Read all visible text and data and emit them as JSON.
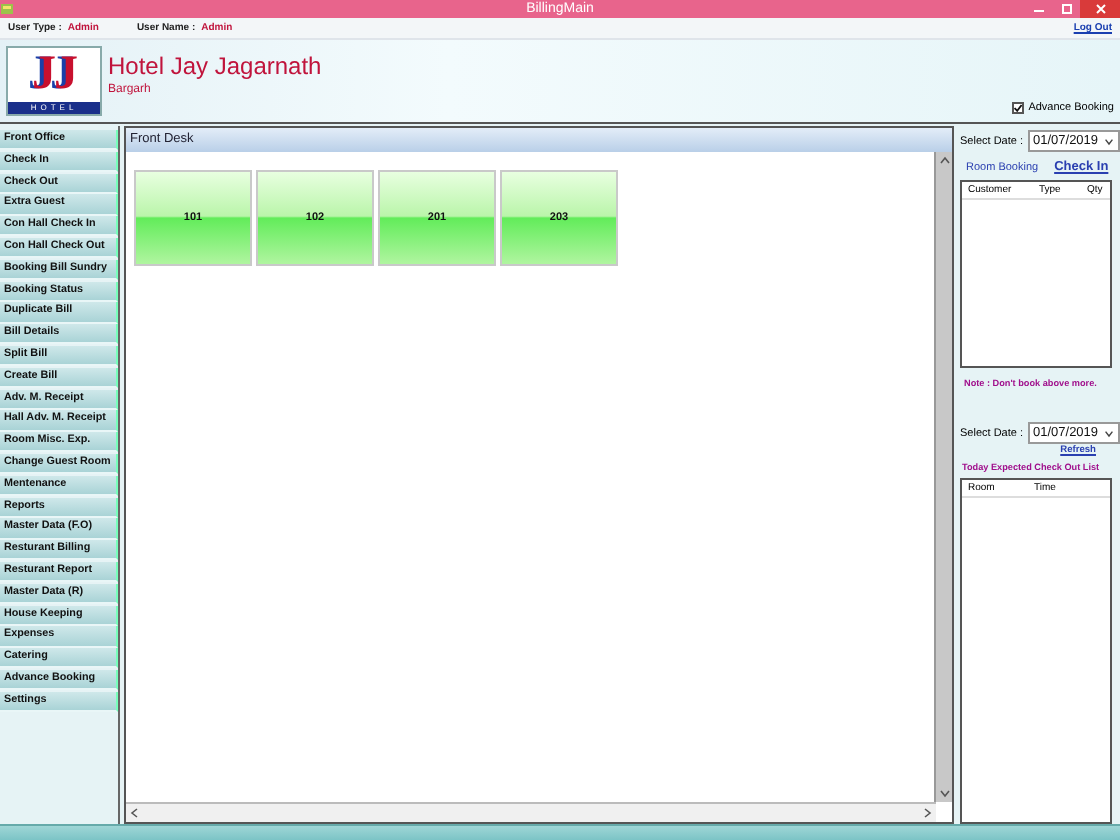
{
  "window": {
    "title": "BillingMain"
  },
  "user_bar": {
    "user_type_label": "User Type :",
    "user_type": "Admin",
    "user_name_label": "User Name :",
    "user_name": "Admin",
    "logout": "Log Out"
  },
  "hotel": {
    "logo_letters": "JJ",
    "logo_caption": "HOTEL",
    "name": "Hotel Jay Jagarnath",
    "location": "Bargarh"
  },
  "advance_booking": {
    "label": "Advance Booking",
    "checked": true
  },
  "menu": [
    "Front Office",
    "Check In",
    "Check Out",
    "Extra Guest",
    "Con Hall Check In",
    "Con Hall Check Out",
    "Booking Bill Sundry",
    "Booking Status",
    "Duplicate Bill",
    "Bill Details",
    "Split Bill",
    "Create Bill",
    "Adv. M. Receipt",
    "Hall Adv. M. Receipt",
    "Room Misc. Exp.",
    "Change Guest Room",
    "Mentenance",
    "Reports",
    "Master Data (F.O)",
    "Resturant Billing",
    "Resturant Report",
    "Master Data (R)",
    "House Keeping",
    "Expenses",
    "Catering",
    "Advance Booking",
    "Settings"
  ],
  "front_desk": {
    "title": "Front Desk",
    "rooms": [
      "101",
      "102",
      "201",
      "203"
    ]
  },
  "booking": {
    "date_label": "Select Date :",
    "date": "01/07/2019",
    "tabs": [
      {
        "label": "Room Booking",
        "selected": false
      },
      {
        "label": "Check In",
        "selected": true
      }
    ],
    "columns": [
      "Customer",
      "Type",
      "Qty"
    ],
    "note": "Note : Don't book  above more."
  },
  "checkout": {
    "date_label": "Select Date :",
    "date": "01/07/2019",
    "refresh": "Refresh",
    "title": "Today Expected Check Out List",
    "columns": [
      "Room",
      "Time"
    ]
  }
}
